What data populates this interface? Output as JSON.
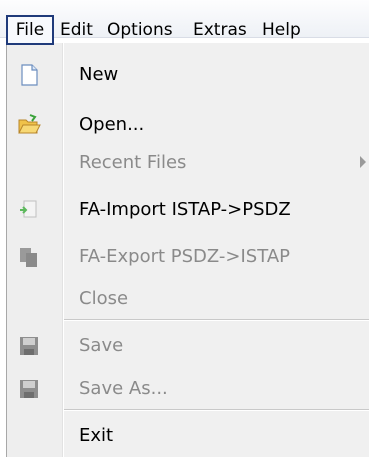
{
  "menubar": {
    "items": [
      "File",
      "Edit",
      "Options",
      "Extras",
      "Help"
    ]
  },
  "file_menu": {
    "new": "New",
    "open": "Open...",
    "recent_files": "Recent Files",
    "fa_import": "FA-Import ISTAP->PSDZ",
    "fa_export": "FA-Export PSDZ->ISTAP",
    "close": "Close",
    "save": "Save",
    "save_as": "Save As...",
    "exit": "Exit"
  },
  "icons": {
    "new": "new-document-icon",
    "open": "open-folder-icon",
    "fa_import": "fa-import-icon",
    "fa_export": "fa-export-icon",
    "save": "save-disk-icon",
    "save_as": "save-as-disk-icon"
  }
}
